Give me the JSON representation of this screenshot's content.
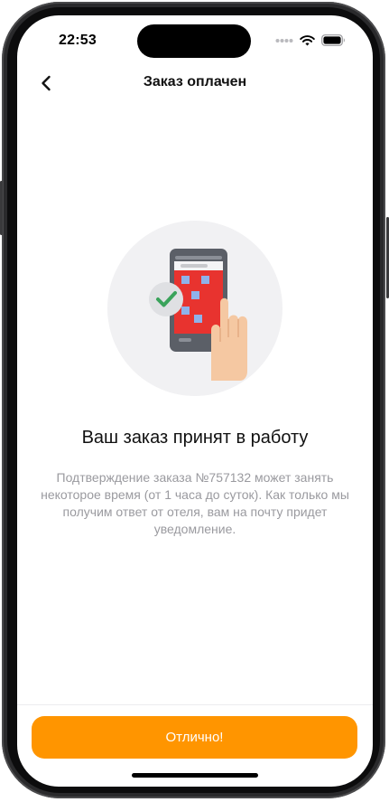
{
  "status_bar": {
    "time": "22:53",
    "icons": [
      "signal-dots-icon",
      "wifi-icon",
      "battery-icon"
    ]
  },
  "nav": {
    "back_icon": "chevron-left-icon",
    "title": "Заказ оплачен"
  },
  "content": {
    "illustration": "phone-with-hotel-and-check-illustration",
    "headline": "Ваш заказ принят в работу",
    "message": "Подтверждение заказа №757132 может занять некоторое время (от 1 часа до суток). Как только мы получим ответ от отеля, вам на почту придет уведомление."
  },
  "footer": {
    "button_label": "Отлично!"
  },
  "colors": {
    "accent": "#ff9500",
    "check_green": "#3aa35b",
    "hotel_red": "#e8332f",
    "text_primary": "#111111",
    "text_secondary": "#9a9a9f"
  }
}
